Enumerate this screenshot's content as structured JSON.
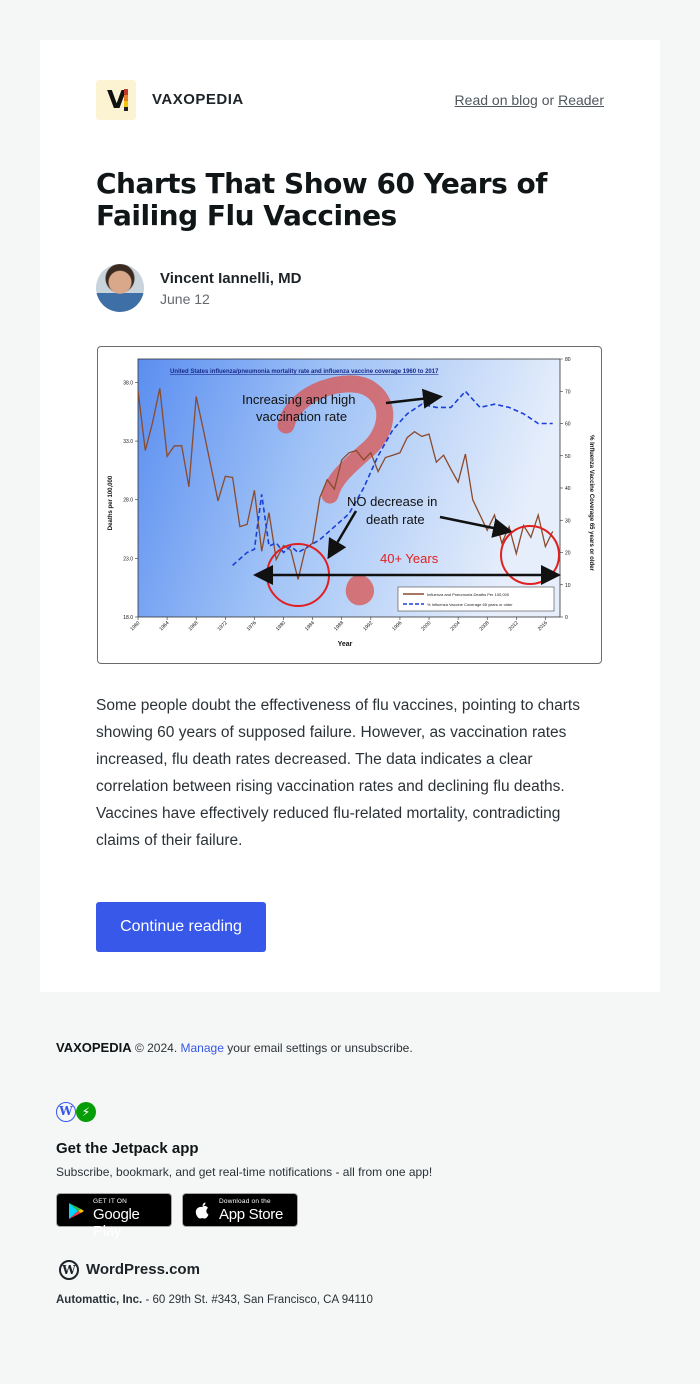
{
  "header": {
    "site_name": "VAXOPEDIA",
    "read_on_blog": "Read on blog",
    "or": "or",
    "reader": "Reader"
  },
  "post": {
    "title": "Charts That Show 60 Years of Failing Flu Vaccines",
    "author": "Vincent Iannelli, MD",
    "date": "June 12",
    "excerpt": "Some people doubt the effectiveness of flu vaccines, pointing to charts showing 60 years of supposed failure. However, as vaccination rates increased, flu death rates decreased. The data indicates a clear correlation between rising vaccination rates and declining flu deaths. Vaccines have effectively reduced flu-related mortality, contradicting claims of their failure.",
    "continue_label": "Continue reading"
  },
  "figure": {
    "chart_title": "United States influenza/pneumonia mortality rate and influenza vaccine coverage 1960 to 2017",
    "annotation_1": [
      "Increasing and high",
      "vaccination rate"
    ],
    "annotation_2": [
      "NO decrease in",
      "death rate"
    ],
    "annotation_3": "40+ Years",
    "legend_1": "Influenza and Pneumonia Deaths Per 100,000",
    "legend_2": "% Influenza Vaccine Coverage 65 years or older",
    "colors": {
      "mortality": "#8b4a2b",
      "coverage": "#1a3fd6",
      "annotation": "#e03030"
    }
  },
  "chart_data": {
    "type": "line",
    "title": "United States influenza/pneumonia mortality rate and influenza vaccine coverage 1960 to 2017",
    "xlabel": "Year",
    "ylabel": "Deaths per 100,000",
    "y2label": "% Influenza Vaccine Coverage 65 years or older",
    "x_ticks": [
      "1960",
      "1964",
      "1968",
      "1972",
      "1976",
      "1980",
      "1984",
      "1988",
      "1992",
      "1996",
      "2000",
      "2004",
      "2008",
      "2012",
      "2016"
    ],
    "y_ticks": [
      "18.0",
      "23.0",
      "28.0",
      "33.0",
      "38.0"
    ],
    "y2_ticks": [
      "0",
      "10",
      "20",
      "30",
      "40",
      "50",
      "60",
      "70",
      "80"
    ],
    "ylim": [
      18,
      40
    ],
    "y2lim": [
      0,
      80
    ],
    "series": [
      {
        "name": "Influenza and Pneumonia Deaths Per 100,000",
        "axis": "left",
        "x": [
          1960,
          1961,
          1962,
          1963,
          1964,
          1965,
          1966,
          1967,
          1968,
          1969,
          1970,
          1971,
          1972,
          1973,
          1974,
          1975,
          1976,
          1977,
          1978,
          1979,
          1980,
          1981,
          1982,
          1983,
          1984,
          1985,
          1986,
          1987,
          1988,
          1989,
          1990,
          1991,
          1992,
          1993,
          1994,
          1995,
          1996,
          1997,
          1998,
          1999,
          2000,
          2001,
          2002,
          2003,
          2004,
          2005,
          2006,
          2007,
          2008,
          2009,
          2010,
          2011,
          2012,
          2013,
          2014,
          2015,
          2016,
          2017
        ],
        "values": [
          37.3,
          32.2,
          34.6,
          37.5,
          31.7,
          32.6,
          32.6,
          29.1,
          36.8,
          33.9,
          30.9,
          27.9,
          30.0,
          29.9,
          25.7,
          25.9,
          28.8,
          23.6,
          26.9,
          22.9,
          24.1,
          23.7,
          21.2,
          23.8,
          24.3,
          28.2,
          29.7,
          28.9,
          31.4,
          32.0,
          32.2,
          31.4,
          32.0,
          30.4,
          31.6,
          31.8,
          32.0,
          33.3,
          33.8,
          33.4,
          33.6,
          31.2,
          31.8,
          30.6,
          29.5,
          31.9,
          28.0,
          26.7,
          25.4,
          26.7,
          24.3,
          25.7,
          23.4,
          25.8,
          24.8,
          26.7,
          24.0,
          25.3
        ]
      },
      {
        "name": "% Influenza Vaccine Coverage 65 years or older",
        "axis": "right",
        "x": [
          1973,
          1975,
          1976,
          1977,
          1978,
          1979,
          1980,
          1981,
          1982,
          1985,
          1987,
          1989,
          1991,
          1993,
          1995,
          1997,
          1999,
          2001,
          2003,
          2005,
          2007,
          2009,
          2011,
          2013,
          2015,
          2017
        ],
        "values": [
          16,
          20,
          21,
          38,
          22,
          23,
          20,
          22,
          20,
          24,
          28,
          32,
          40,
          50,
          58,
          63,
          66,
          65,
          65,
          70,
          65,
          66,
          65,
          63,
          60,
          60
        ]
      }
    ],
    "grid": false,
    "legend": "bottom-right"
  },
  "footer": {
    "brand": "VAXOPEDIA",
    "copyright": "© 2024.",
    "manage": "Manage",
    "manage_rest": "your email settings or unsubscribe.",
    "jetpack_title": "Get the Jetpack app",
    "jetpack_sub": "Subscribe, bookmark, and get real-time notifications - all from one app!",
    "gp_small": "GET IT ON",
    "gp_big": "Google Play",
    "as_small": "Download on the",
    "as_big": "App Store",
    "wordpress": "WordPress.com",
    "address_company": "Automattic, Inc.",
    "address_rest": "- 60 29th St. #343, San Francisco, CA 94110"
  }
}
